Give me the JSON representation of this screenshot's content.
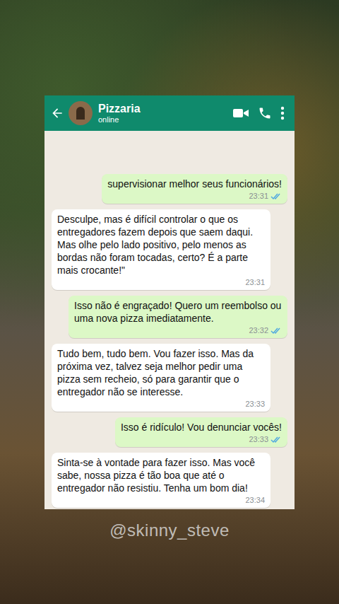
{
  "chat": {
    "title": "Pizzaria",
    "status": "online"
  },
  "messages": [
    {
      "kind": "outgoing",
      "text": "supervisionar melhor seus funcionários!",
      "time": "23:31",
      "read": true
    },
    {
      "kind": "incoming",
      "text": "Desculpe, mas é difícil controlar o que os entregadores fazem depois que saem daqui. Mas olhe pelo lado positivo, pelo menos as bordas não foram tocadas, certo? É a parte mais crocante!\"",
      "time": "23:31",
      "read": false
    },
    {
      "kind": "outgoing",
      "text": "Isso não é engraçado! Quero um reembolso ou uma nova pizza imediatamente.",
      "time": "23:32",
      "read": true
    },
    {
      "kind": "incoming",
      "text": "Tudo bem, tudo bem. Vou fazer isso. Mas da próxima vez, talvez seja melhor pedir uma pizza sem recheio, só para garantir que o entregador não se interesse.",
      "time": "23:33",
      "read": false
    },
    {
      "kind": "outgoing",
      "text": "Isso é ridículo! Vou denunciar vocês!",
      "time": "23:33",
      "read": true
    },
    {
      "kind": "incoming",
      "text": "Sinta-se à vontade para fazer isso. Mas você sabe, nossa pizza é tão boa que até o entregador não resistiu. Tenha um bom dia!",
      "time": "23:34",
      "read": false
    }
  ],
  "watermark": "@skinny_steve"
}
